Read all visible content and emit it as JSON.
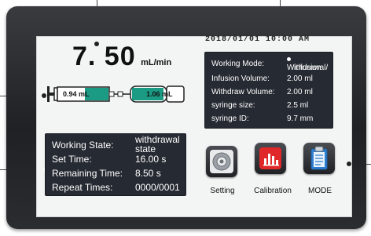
{
  "flow": {
    "value": "7. 50",
    "unit": "mL/min"
  },
  "datetime": "2018/01/01  10:00 AM",
  "syringes": {
    "left_volume": "0.94 mL",
    "right_volume": "1.06 mL"
  },
  "info_panel": {
    "rows": [
      {
        "label": "Working Mode:",
        "value": "Withdrawal/",
        "value2": "infusion"
      },
      {
        "label": "Infusion Volume:",
        "value": "2.00  ml"
      },
      {
        "label": "Withdraw Volume:",
        "value": "2.00  ml"
      },
      {
        "label": "syringe size:",
        "value": "2.5   ml"
      },
      {
        "label": "syringe ID:",
        "value": "9.7   mm"
      }
    ]
  },
  "state_panel": {
    "rows": [
      {
        "label": "Working State:",
        "value": "withdrawal",
        "value2": "state"
      },
      {
        "label": "Set Time:",
        "value": "16.00  s"
      },
      {
        "label": "Remaining Time:",
        "value": "8.50   s"
      },
      {
        "label": "Repeat Times:",
        "value": "0000/0001"
      }
    ]
  },
  "buttons": [
    {
      "label": "Setting",
      "icon": "gear-icon"
    },
    {
      "label": "Calibration",
      "icon": "bar-chart-icon"
    },
    {
      "label": "MODE",
      "icon": "clipboard-icon"
    }
  ],
  "colors": {
    "syringe_fill": "#1b9b83",
    "panel": "#262a32",
    "bezel": "#2a2b2f"
  }
}
